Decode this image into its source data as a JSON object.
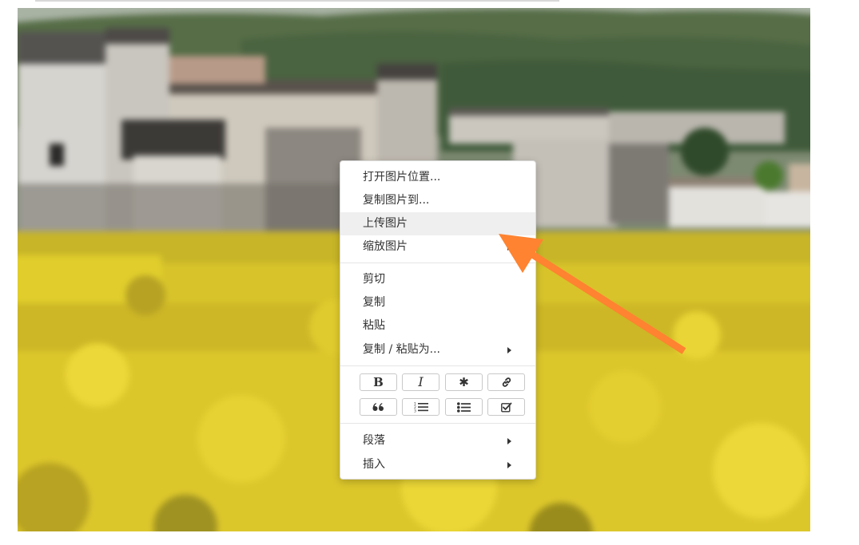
{
  "context_menu": {
    "image_items": [
      {
        "label": "打开图片位置...",
        "highlighted": false,
        "has_submenu": false
      },
      {
        "label": "复制图片到...",
        "highlighted": false,
        "has_submenu": false
      },
      {
        "label": "上传图片",
        "highlighted": true,
        "has_submenu": false
      },
      {
        "label": "缩放图片",
        "highlighted": false,
        "has_submenu": true
      }
    ],
    "edit_items": [
      {
        "label": "剪切",
        "has_submenu": false
      },
      {
        "label": "复制",
        "has_submenu": false
      },
      {
        "label": "粘贴",
        "has_submenu": false
      },
      {
        "label": "复制 / 粘贴为...",
        "has_submenu": true
      }
    ],
    "format_buttons": [
      {
        "icon": "bold-icon",
        "glyph": "B"
      },
      {
        "icon": "italic-icon",
        "glyph": "I"
      },
      {
        "icon": "asterisk-icon",
        "glyph": "✱"
      },
      {
        "icon": "link-icon"
      },
      {
        "icon": "quote-icon"
      },
      {
        "icon": "ordered-list-icon"
      },
      {
        "icon": "unordered-list-icon"
      },
      {
        "icon": "checkbox-icon"
      }
    ],
    "block_items": [
      {
        "label": "段落",
        "has_submenu": true
      },
      {
        "label": "插入",
        "has_submenu": true
      }
    ]
  },
  "colors": {
    "annotation_arrow": "#ff8330",
    "menu_highlight": "#efefef",
    "menu_text": "#333333"
  }
}
